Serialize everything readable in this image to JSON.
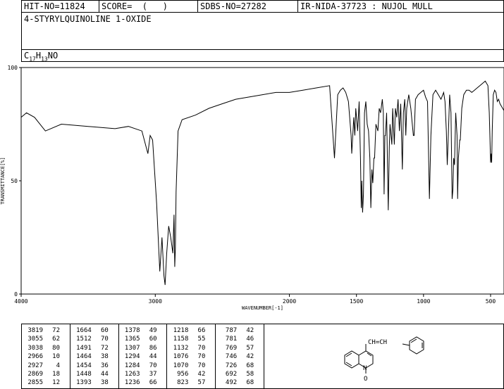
{
  "header": {
    "hit_no": "HIT-NO=11824",
    "score": "SCORE=  (   )",
    "sdbs_no": "SDBS-NO=27282",
    "ir_info": "IR-NIDA-37723 : NUJOL MULL"
  },
  "compound_name": "4-STYRYLQUINOLINE 1-OXIDE",
  "formula": {
    "c": "C",
    "c_n": "17",
    "h": "H",
    "h_n": "13",
    "rest": "NO"
  },
  "chart_data": {
    "type": "line",
    "xlabel": "WAVENUMBER[-1]",
    "ylabel": "TRANSMITTANCE[%]",
    "xlim": [
      4000,
      400
    ],
    "ylim": [
      0,
      100
    ],
    "x_ticks": [
      4000,
      3000,
      2000,
      1500,
      1000,
      500
    ],
    "y_ticks": [
      0,
      50,
      100
    ],
    "series": [
      {
        "x": [
          4000,
          3960,
          3900,
          3819,
          3700,
          3500,
          3300,
          3200,
          3100,
          3055,
          3038,
          3020,
          2990,
          2966,
          2950,
          2935,
          2927,
          2915,
          2900,
          2885,
          2869,
          2860,
          2855,
          2850,
          2845,
          2830,
          2800,
          2700,
          2600,
          2500,
          2400,
          2300,
          2200,
          2100,
          2000,
          1900,
          1800,
          1700,
          1664,
          1640,
          1620,
          1600,
          1580,
          1560,
          1540,
          1535,
          1520,
          1512,
          1505,
          1491,
          1480,
          1470,
          1464,
          1460,
          1454,
          1448,
          1440,
          1430,
          1420,
          1410,
          1400,
          1393,
          1385,
          1378,
          1370,
          1365,
          1355,
          1340,
          1330,
          1320,
          1307,
          1300,
          1294,
          1288,
          1284,
          1275,
          1263,
          1255,
          1250,
          1236,
          1230,
          1218,
          1210,
          1200,
          1190,
          1180,
          1170,
          1158,
          1150,
          1140,
          1132,
          1125,
          1110,
          1095,
          1076,
          1070,
          1060,
          1040,
          1020,
          1000,
          985,
          970,
          956,
          945,
          930,
          910,
          890,
          870,
          850,
          840,
          830,
          823,
          815,
          805,
          795,
          787,
          781,
          775,
          769,
          760,
          750,
          746,
          740,
          730,
          726,
          715,
          700,
          680,
          660,
          640,
          620,
          600,
          580,
          560,
          540,
          520,
          510,
          500,
          495,
          492,
          488,
          480,
          470,
          460,
          450,
          440,
          430,
          420,
          410,
          400
        ],
        "y": [
          78,
          80,
          78,
          72,
          75,
          74,
          73,
          74,
          72,
          62,
          70,
          68,
          40,
          10,
          25,
          8,
          4,
          18,
          30,
          25,
          18,
          35,
          12,
          20,
          45,
          72,
          77,
          79,
          82,
          84,
          86,
          87,
          88,
          89,
          89,
          90,
          91,
          92,
          60,
          88,
          90,
          91,
          89,
          85,
          70,
          62,
          78,
          70,
          82,
          72,
          85,
          60,
          38,
          50,
          36,
          44,
          80,
          85,
          75,
          72,
          60,
          38,
          55,
          49,
          60,
          60,
          75,
          72,
          82,
          80,
          86,
          80,
          44,
          70,
          70,
          80,
          37,
          65,
          75,
          66,
          82,
          66,
          82,
          78,
          86,
          72,
          84,
          55,
          80,
          86,
          70,
          82,
          88,
          82,
          70,
          70,
          86,
          88,
          89,
          90,
          87,
          85,
          42,
          70,
          88,
          90,
          88,
          86,
          89,
          85,
          72,
          57,
          70,
          88,
          80,
          42,
          46,
          60,
          57,
          80,
          70,
          42,
          60,
          68,
          68,
          82,
          88,
          90,
          90,
          89,
          90,
          91,
          92,
          93,
          94,
          92,
          80,
          58,
          62,
          58,
          72,
          88,
          90,
          89,
          85,
          86,
          84,
          83,
          82,
          81
        ]
      }
    ]
  },
  "peak_table": [
    [
      [
        "3819",
        "72"
      ],
      [
        "3055",
        "62"
      ],
      [
        "3038",
        "80"
      ],
      [
        "2966",
        "10"
      ],
      [
        "2927",
        "4"
      ],
      [
        "2869",
        "18"
      ],
      [
        "2855",
        "12"
      ]
    ],
    [
      [
        "1664",
        "60"
      ],
      [
        "1512",
        "70"
      ],
      [
        "1491",
        "72"
      ],
      [
        "1464",
        "38"
      ],
      [
        "1454",
        "36"
      ],
      [
        "1448",
        "44"
      ],
      [
        "1393",
        "38"
      ]
    ],
    [
      [
        "1378",
        "49"
      ],
      [
        "1365",
        "60"
      ],
      [
        "1307",
        "86"
      ],
      [
        "1294",
        "44"
      ],
      [
        "1284",
        "70"
      ],
      [
        "1263",
        "37"
      ],
      [
        "1236",
        "66"
      ]
    ],
    [
      [
        "1218",
        "66"
      ],
      [
        "1158",
        "55"
      ],
      [
        "1132",
        "70"
      ],
      [
        "1076",
        "70"
      ],
      [
        "1070",
        "70"
      ],
      [
        "956",
        "42"
      ],
      [
        "823",
        "57"
      ]
    ],
    [
      [
        "787",
        "42"
      ],
      [
        "781",
        "46"
      ],
      [
        "769",
        "57"
      ],
      [
        "746",
        "42"
      ],
      [
        "726",
        "68"
      ],
      [
        "692",
        "58"
      ],
      [
        "492",
        "68"
      ]
    ]
  ],
  "structure": {
    "substituent": "CH=CH",
    "oxide": "O"
  }
}
